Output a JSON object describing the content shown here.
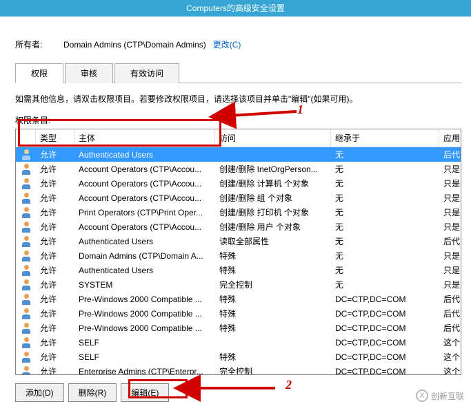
{
  "window": {
    "title": "Computers的高级安全设置"
  },
  "owner": {
    "label": "所有者:",
    "value": "Domain Admins (CTP\\Domain Admins)",
    "change": "更改(C)"
  },
  "tabs": [
    {
      "label": "权限",
      "active": true
    },
    {
      "label": "审核",
      "active": false
    },
    {
      "label": "有效访问",
      "active": false
    }
  ],
  "info_text": "如需其他信息，请双击权限项目。若要修改权限项目，请选择该项目并单击\"编辑\"(如果可用)。",
  "list_label": "权限条目:",
  "columns": {
    "type": "类型",
    "principal": "主体",
    "access": "访问",
    "inherit": "继承于",
    "apply": "应用于"
  },
  "rows": [
    {
      "type": "允许",
      "principal": "Authenticated Users",
      "access": "",
      "inherit": "无",
      "apply": "后代",
      "selected": true
    },
    {
      "type": "允许",
      "principal": "Account Operators (CTP\\Accou...",
      "access": "创建/删除 InetOrgPerson...",
      "inherit": "无",
      "apply": "只是"
    },
    {
      "type": "允许",
      "principal": "Account Operators (CTP\\Accou...",
      "access": "创建/删除 计算机 个对象",
      "inherit": "无",
      "apply": "只是"
    },
    {
      "type": "允许",
      "principal": "Account Operators (CTP\\Accou...",
      "access": "创建/删除 组 个对象",
      "inherit": "无",
      "apply": "只是"
    },
    {
      "type": "允许",
      "principal": "Print Operators (CTP\\Print Oper...",
      "access": "创建/删除 打印机 个对象",
      "inherit": "无",
      "apply": "只是"
    },
    {
      "type": "允许",
      "principal": "Account Operators (CTP\\Accou...",
      "access": "创建/删除 用户 个对象",
      "inherit": "无",
      "apply": "只是"
    },
    {
      "type": "允许",
      "principal": "Authenticated Users",
      "access": "读取全部属性",
      "inherit": "无",
      "apply": "后代"
    },
    {
      "type": "允许",
      "principal": "Domain Admins (CTP\\Domain A...",
      "access": "特殊",
      "inherit": "无",
      "apply": "只是"
    },
    {
      "type": "允许",
      "principal": "Authenticated Users",
      "access": "特殊",
      "inherit": "无",
      "apply": "只是"
    },
    {
      "type": "允许",
      "principal": "SYSTEM",
      "access": "完全控制",
      "inherit": "无",
      "apply": "只是"
    },
    {
      "type": "允许",
      "principal": "Pre-Windows 2000 Compatible ...",
      "access": "特殊",
      "inherit": "DC=CTP,DC=COM",
      "apply": "后代"
    },
    {
      "type": "允许",
      "principal": "Pre-Windows 2000 Compatible ...",
      "access": "特殊",
      "inherit": "DC=CTP,DC=COM",
      "apply": "后代"
    },
    {
      "type": "允许",
      "principal": "Pre-Windows 2000 Compatible ...",
      "access": "特殊",
      "inherit": "DC=CTP,DC=COM",
      "apply": "后代"
    },
    {
      "type": "允许",
      "principal": "SELF",
      "access": "",
      "inherit": "DC=CTP,DC=COM",
      "apply": "这个"
    },
    {
      "type": "允许",
      "principal": "SELF",
      "access": "特殊",
      "inherit": "DC=CTP,DC=COM",
      "apply": "这个"
    },
    {
      "type": "允许",
      "principal": "Enterprise Admins (CTP\\Enterpr...",
      "access": "完全控制",
      "inherit": "DC=CTP,DC=COM",
      "apply": "这个"
    }
  ],
  "buttons": {
    "add": "添加(D)",
    "remove": "删除(R)",
    "edit": "编辑(E)"
  },
  "annotations": {
    "label1": "1",
    "label2": "2"
  },
  "watermark": {
    "text": "创新互联",
    "icon": "X"
  }
}
